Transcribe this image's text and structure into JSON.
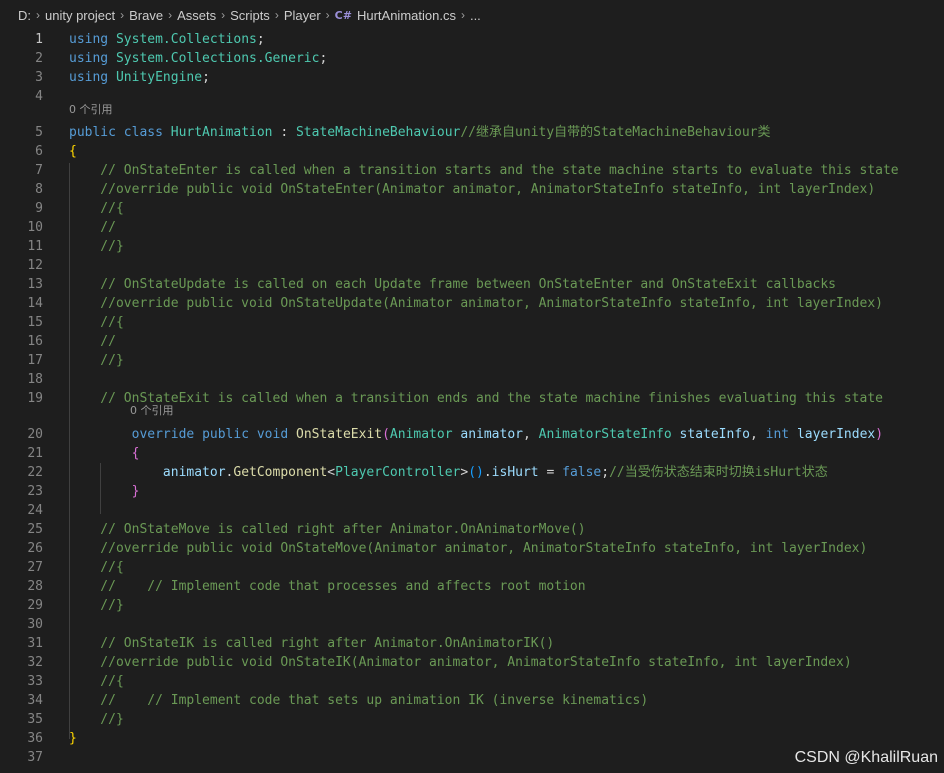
{
  "breadcrumb": {
    "items": [
      "D:",
      "unity project",
      "Brave",
      "Assets",
      "Scripts",
      "Player"
    ],
    "file_icon": "C#",
    "file": "HurtAnimation.cs",
    "more": "..."
  },
  "codelens": {
    "class_refs": "0 个引用",
    "method_refs": "0 个引用"
  },
  "code": {
    "lines": [
      {
        "n": "1",
        "t": [
          [
            "kw",
            "using "
          ],
          [
            "ns",
            "System.Collections"
          ],
          [
            "pl",
            ";"
          ]
        ]
      },
      {
        "n": "2",
        "t": [
          [
            "kw",
            "using "
          ],
          [
            "ns",
            "System.Collections.Generic"
          ],
          [
            "pl",
            ";"
          ]
        ]
      },
      {
        "n": "3",
        "t": [
          [
            "kw",
            "using "
          ],
          [
            "ns",
            "UnityEngine"
          ],
          [
            "pl",
            ";"
          ]
        ]
      },
      {
        "n": "4",
        "t": []
      },
      {
        "n": "5",
        "t": [
          [
            "kw",
            "public class "
          ],
          [
            "ty",
            "HurtAnimation"
          ],
          [
            "pl",
            " : "
          ],
          [
            "ty",
            "StateMachineBehaviour"
          ],
          [
            "cm",
            "//继承自unity自带的StateMachineBehaviour类"
          ]
        ]
      },
      {
        "n": "6",
        "t": [
          [
            "br1",
            "{"
          ]
        ]
      },
      {
        "n": "7",
        "t": [
          [
            "cm",
            "    // OnStateEnter is called when a transition starts and the state machine starts to evaluate this state"
          ]
        ]
      },
      {
        "n": "8",
        "t": [
          [
            "cm",
            "    //override public void OnStateEnter(Animator animator, AnimatorStateInfo stateInfo, int layerIndex)"
          ]
        ]
      },
      {
        "n": "9",
        "t": [
          [
            "cm",
            "    //{"
          ]
        ]
      },
      {
        "n": "10",
        "t": [
          [
            "cm",
            "    //"
          ]
        ]
      },
      {
        "n": "11",
        "t": [
          [
            "cm",
            "    //}"
          ]
        ]
      },
      {
        "n": "12",
        "t": []
      },
      {
        "n": "13",
        "t": [
          [
            "cm",
            "    // OnStateUpdate is called on each Update frame between OnStateEnter and OnStateExit callbacks"
          ]
        ]
      },
      {
        "n": "14",
        "t": [
          [
            "cm",
            "    //override public void OnStateUpdate(Animator animator, AnimatorStateInfo stateInfo, int layerIndex)"
          ]
        ]
      },
      {
        "n": "15",
        "t": [
          [
            "cm",
            "    //{"
          ]
        ]
      },
      {
        "n": "16",
        "t": [
          [
            "cm",
            "    //"
          ]
        ]
      },
      {
        "n": "17",
        "t": [
          [
            "cm",
            "    //}"
          ]
        ]
      },
      {
        "n": "18",
        "t": []
      },
      {
        "n": "19",
        "t": [
          [
            "cm",
            "    // OnStateExit is called when a transition ends and the state machine finishes evaluating this state"
          ]
        ]
      },
      {
        "n": "20",
        "t": [
          [
            "pl",
            "        "
          ],
          [
            "kw",
            "override public void "
          ],
          [
            "fn",
            "OnStateExit"
          ],
          [
            "br2",
            "("
          ],
          [
            "ty",
            "Animator "
          ],
          [
            "pa",
            "animator"
          ],
          [
            "pl",
            ", "
          ],
          [
            "ty",
            "AnimatorStateInfo "
          ],
          [
            "pa",
            "stateInfo"
          ],
          [
            "pl",
            ", "
          ],
          [
            "kw",
            "int "
          ],
          [
            "pa",
            "layerIndex"
          ],
          [
            "br2",
            ")"
          ]
        ]
      },
      {
        "n": "21",
        "t": [
          [
            "pl",
            "        "
          ],
          [
            "br2",
            "{"
          ]
        ]
      },
      {
        "n": "22",
        "t": [
          [
            "pl",
            "            "
          ],
          [
            "pa",
            "animator"
          ],
          [
            "pl",
            "."
          ],
          [
            "fn",
            "GetComponent"
          ],
          [
            "pl",
            "<"
          ],
          [
            "ty",
            "PlayerController"
          ],
          [
            "pl",
            ">"
          ],
          [
            "br3",
            "()"
          ],
          [
            "pl",
            "."
          ],
          [
            "pa",
            "isHurt"
          ],
          [
            "pl",
            " = "
          ],
          [
            "kw",
            "false"
          ],
          [
            "pl",
            ";"
          ],
          [
            "cm",
            "//当受伤状态结束时切换isHurt状态"
          ]
        ]
      },
      {
        "n": "23",
        "t": [
          [
            "pl",
            "        "
          ],
          [
            "br2",
            "}"
          ]
        ]
      },
      {
        "n": "24",
        "t": []
      },
      {
        "n": "25",
        "t": [
          [
            "cm",
            "    // OnStateMove is called right after Animator.OnAnimatorMove()"
          ]
        ]
      },
      {
        "n": "26",
        "t": [
          [
            "cm",
            "    //override public void OnStateMove(Animator animator, AnimatorStateInfo stateInfo, int layerIndex)"
          ]
        ]
      },
      {
        "n": "27",
        "t": [
          [
            "cm",
            "    //{"
          ]
        ]
      },
      {
        "n": "28",
        "t": [
          [
            "cm",
            "    //    // Implement code that processes and affects root motion"
          ]
        ]
      },
      {
        "n": "29",
        "t": [
          [
            "cm",
            "    //}"
          ]
        ]
      },
      {
        "n": "30",
        "t": []
      },
      {
        "n": "31",
        "t": [
          [
            "cm",
            "    // OnStateIK is called right after Animator.OnAnimatorIK()"
          ]
        ]
      },
      {
        "n": "32",
        "t": [
          [
            "cm",
            "    //override public void OnStateIK(Animator animator, AnimatorStateInfo stateInfo, int layerIndex)"
          ]
        ]
      },
      {
        "n": "33",
        "t": [
          [
            "cm",
            "    //{"
          ]
        ]
      },
      {
        "n": "34",
        "t": [
          [
            "cm",
            "    //    // Implement code that sets up animation IK (inverse kinematics)"
          ]
        ]
      },
      {
        "n": "35",
        "t": [
          [
            "cm",
            "    //}"
          ]
        ]
      },
      {
        "n": "36",
        "t": [
          [
            "br1",
            "}"
          ]
        ]
      },
      {
        "n": "37",
        "t": []
      }
    ]
  },
  "watermark": "CSDN @KhalilRuan",
  "colors": {
    "keyword": "#569cd6",
    "type": "#4ec9b0",
    "function": "#dcdcaa",
    "param": "#9cdcfe",
    "comment": "#6a9955",
    "background": "#1e1e1e"
  }
}
